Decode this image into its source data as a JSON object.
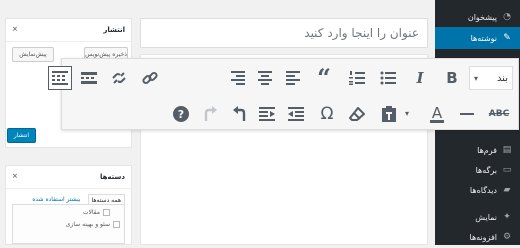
{
  "title_field": {
    "placeholder": "عنوان را اینجا وارد کنید"
  },
  "sidebar": {
    "items": [
      {
        "label": "پیشخوان",
        "icon": "dashboard-icon"
      },
      {
        "label": "نوشته‌ها",
        "icon": "pin-icon",
        "active": true
      },
      {
        "label": "فرم‌ها",
        "icon": "forms-icon"
      },
      {
        "label": "برگه‌ها",
        "icon": "pages-icon"
      },
      {
        "label": "دیدگاه‌ها",
        "icon": "comments-icon"
      },
      {
        "label": "نمایش",
        "icon": "appearance-icon"
      },
      {
        "label": "افزونه‌ها",
        "icon": "plugins-icon"
      }
    ]
  },
  "publish_box": {
    "title": "انتشار",
    "toggle": "×",
    "save_draft": "ذخیره پیش‌نویس",
    "preview": "پیش‌نمایش",
    "publish": "انتشار"
  },
  "categories_box": {
    "title": "دسته‌ها",
    "toggle": "×",
    "tab_all": "همه دسته‌ها",
    "tab_popular": "بیشتر استفاده شده",
    "items": [
      "مقالات",
      "سئو و بهینه سازی"
    ]
  },
  "toolbar": {
    "format_value": "بند",
    "format_caret": "▾",
    "bold_label": "B",
    "italic_label": "I",
    "quote_label": "“",
    "omega_label": "Ω",
    "help_label": "?",
    "strike_label": "ABC",
    "text_color_label": "A",
    "caret_label": "▾"
  }
}
